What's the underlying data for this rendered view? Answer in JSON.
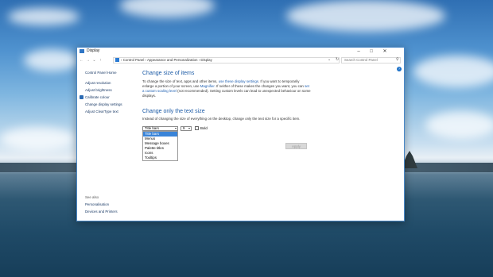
{
  "window": {
    "title": "Display",
    "controls": {
      "minimize": "–",
      "maximize": "□",
      "close": "✕"
    }
  },
  "address_bar": {
    "nav": {
      "back": "←",
      "forward": "→",
      "recent": "⌄",
      "up": "↑"
    },
    "breadcrumbs": [
      "Control Panel",
      "Appearance and Personalization",
      "Display"
    ],
    "separator": "›",
    "search_placeholder": "Search Control Panel"
  },
  "sidebar": {
    "home": "Control Panel Home",
    "links": [
      "Adjust resolution",
      "Adjust brightness",
      "Calibrate colour",
      "Change display settings",
      "Adjust ClearType text"
    ],
    "see_also_heading": "See also",
    "see_also": [
      "Personalisation",
      "Devices and Printers"
    ]
  },
  "main": {
    "heading": "Change size of items",
    "para1_a": "To change the size of text, apps and other items, ",
    "para1_link1": "use these display settings",
    "para1_b": ". If you want to temporarily enlarge a portion of your screen, use ",
    "para1_link2": "Magnifier",
    "para1_c": ". If neither of these makes the changes you want, you can ",
    "para1_link3": "set a custom scaling level",
    "para1_d": " (not recommended). Setting custom levels can lead to unexpected behaviour on some displays.",
    "heading2": "Change only the text size",
    "para2": "Instead of changing the size of everything on the desktop, change only the text size for a specific item.",
    "item_select": {
      "value": "Title bars",
      "options": [
        "Title bars",
        "Menus",
        "Message boxes",
        "Palette titles",
        "Icons",
        "Tooltips"
      ],
      "highlighted_index": 0
    },
    "size_value": "9",
    "bold_label": "Bold",
    "bold_checked": false,
    "apply_label": "Apply"
  }
}
